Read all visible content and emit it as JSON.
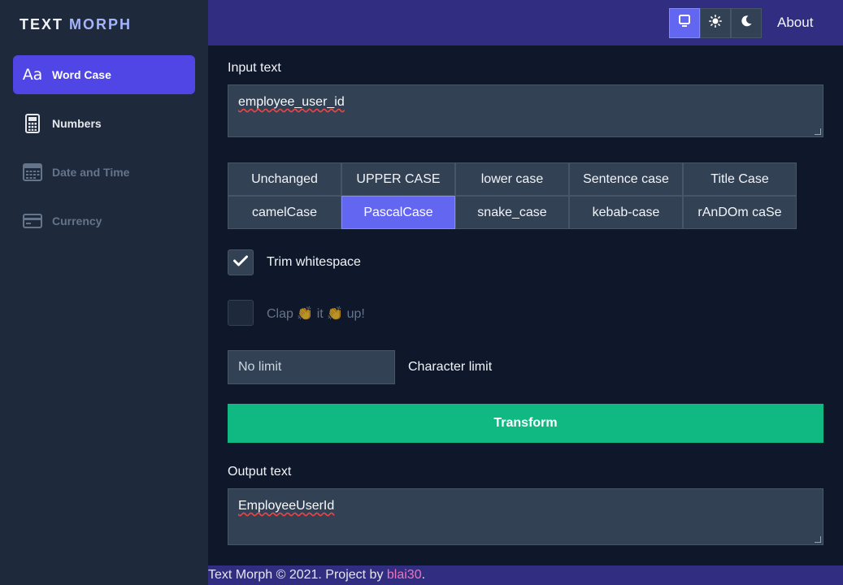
{
  "brand": {
    "part1": "TEXT",
    "part2": "MORPH"
  },
  "sidebar": {
    "items": [
      {
        "label": "Word Case",
        "icon": "text-case-icon",
        "icon_text": "Aa"
      },
      {
        "label": "Numbers",
        "icon": "calculator-icon"
      },
      {
        "label": "Date and Time",
        "icon": "calendar-icon"
      },
      {
        "label": "Currency",
        "icon": "credit-card-icon"
      }
    ]
  },
  "header": {
    "theme_buttons": [
      "desktop-icon",
      "sun-icon",
      "moon-icon"
    ],
    "about_label": "About"
  },
  "input": {
    "label": "Input text",
    "value": "employee_user_id"
  },
  "cases": {
    "row1": [
      "Unchanged",
      "UPPER CASE",
      "lower case",
      "Sentence case",
      "Title Case"
    ],
    "row2": [
      "camelCase",
      "PascalCase",
      "snake_case",
      "kebab-case",
      "rAnDOm caSe"
    ],
    "selected": "PascalCase"
  },
  "options": {
    "trim_label": "Trim whitespace",
    "trim_checked": true,
    "clap_prefix": "Clap",
    "clap_mid": "it",
    "clap_suffix": "up!",
    "clap_emoji": "👏"
  },
  "limit": {
    "value": "No limit",
    "label": "Character limit"
  },
  "transform_label": "Transform",
  "output": {
    "label": "Output text",
    "value": "EmployeeUserId"
  },
  "footer": {
    "text": "Text Morph © 2021. Project by ",
    "link": "blai30",
    "end": "."
  },
  "colors": {
    "accent": "#6366f1",
    "primary_nav": "#4f46e5",
    "transform": "#10b981",
    "header": "#312e81",
    "link": "#f472b6"
  }
}
